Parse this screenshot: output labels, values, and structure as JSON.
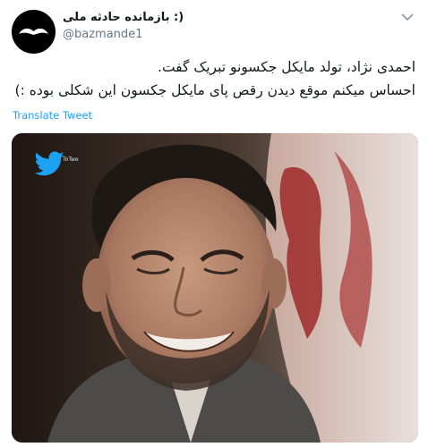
{
  "tweet": {
    "display_name": "بازمانده حادثه ملی :)",
    "handle": "@bazmande1",
    "text_lines": [
      "احمدی نژاد، تولد مایکل جکسونو تبریک گفت.",
      "احساس میکنم موقع دیدن رقص پای مایکل جکسون این شکلی بوده :)"
    ],
    "translate_label": "Translate Tweet"
  },
  "media": {
    "watermark_text": "ToTwe"
  },
  "colors": {
    "accent": "#1da1f2",
    "handle_grey": "#657786",
    "text": "#14171a"
  },
  "icons": {
    "avatar": "mustache-avatar",
    "more": "chevron-down-icon",
    "watermark": "twitter-bird-icon"
  }
}
